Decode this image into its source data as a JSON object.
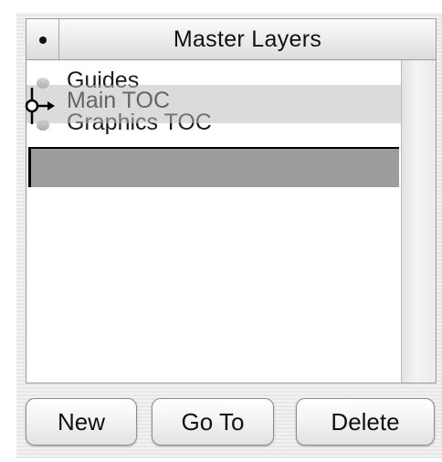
{
  "panel": {
    "title": "Master Layers",
    "column_marker": "•"
  },
  "layers": [
    {
      "label": "Guides",
      "icon": "layer-bullet-icon"
    },
    {
      "label": "Main TOC",
      "icon": "layer-bullet-icon",
      "state": "dragging"
    },
    {
      "label": "Graphics TOC",
      "icon": "layer-bullet-icon"
    }
  ],
  "drop_target": {
    "label": ""
  },
  "buttons": {
    "new_label": "New",
    "goto_label": "Go To",
    "delete_label": "Delete"
  },
  "cursor": {
    "icon": "drag-insert-cursor-icon"
  },
  "colors": {
    "selection_gray": "#9c9c9c",
    "drag_ghost": "#bebebe"
  }
}
